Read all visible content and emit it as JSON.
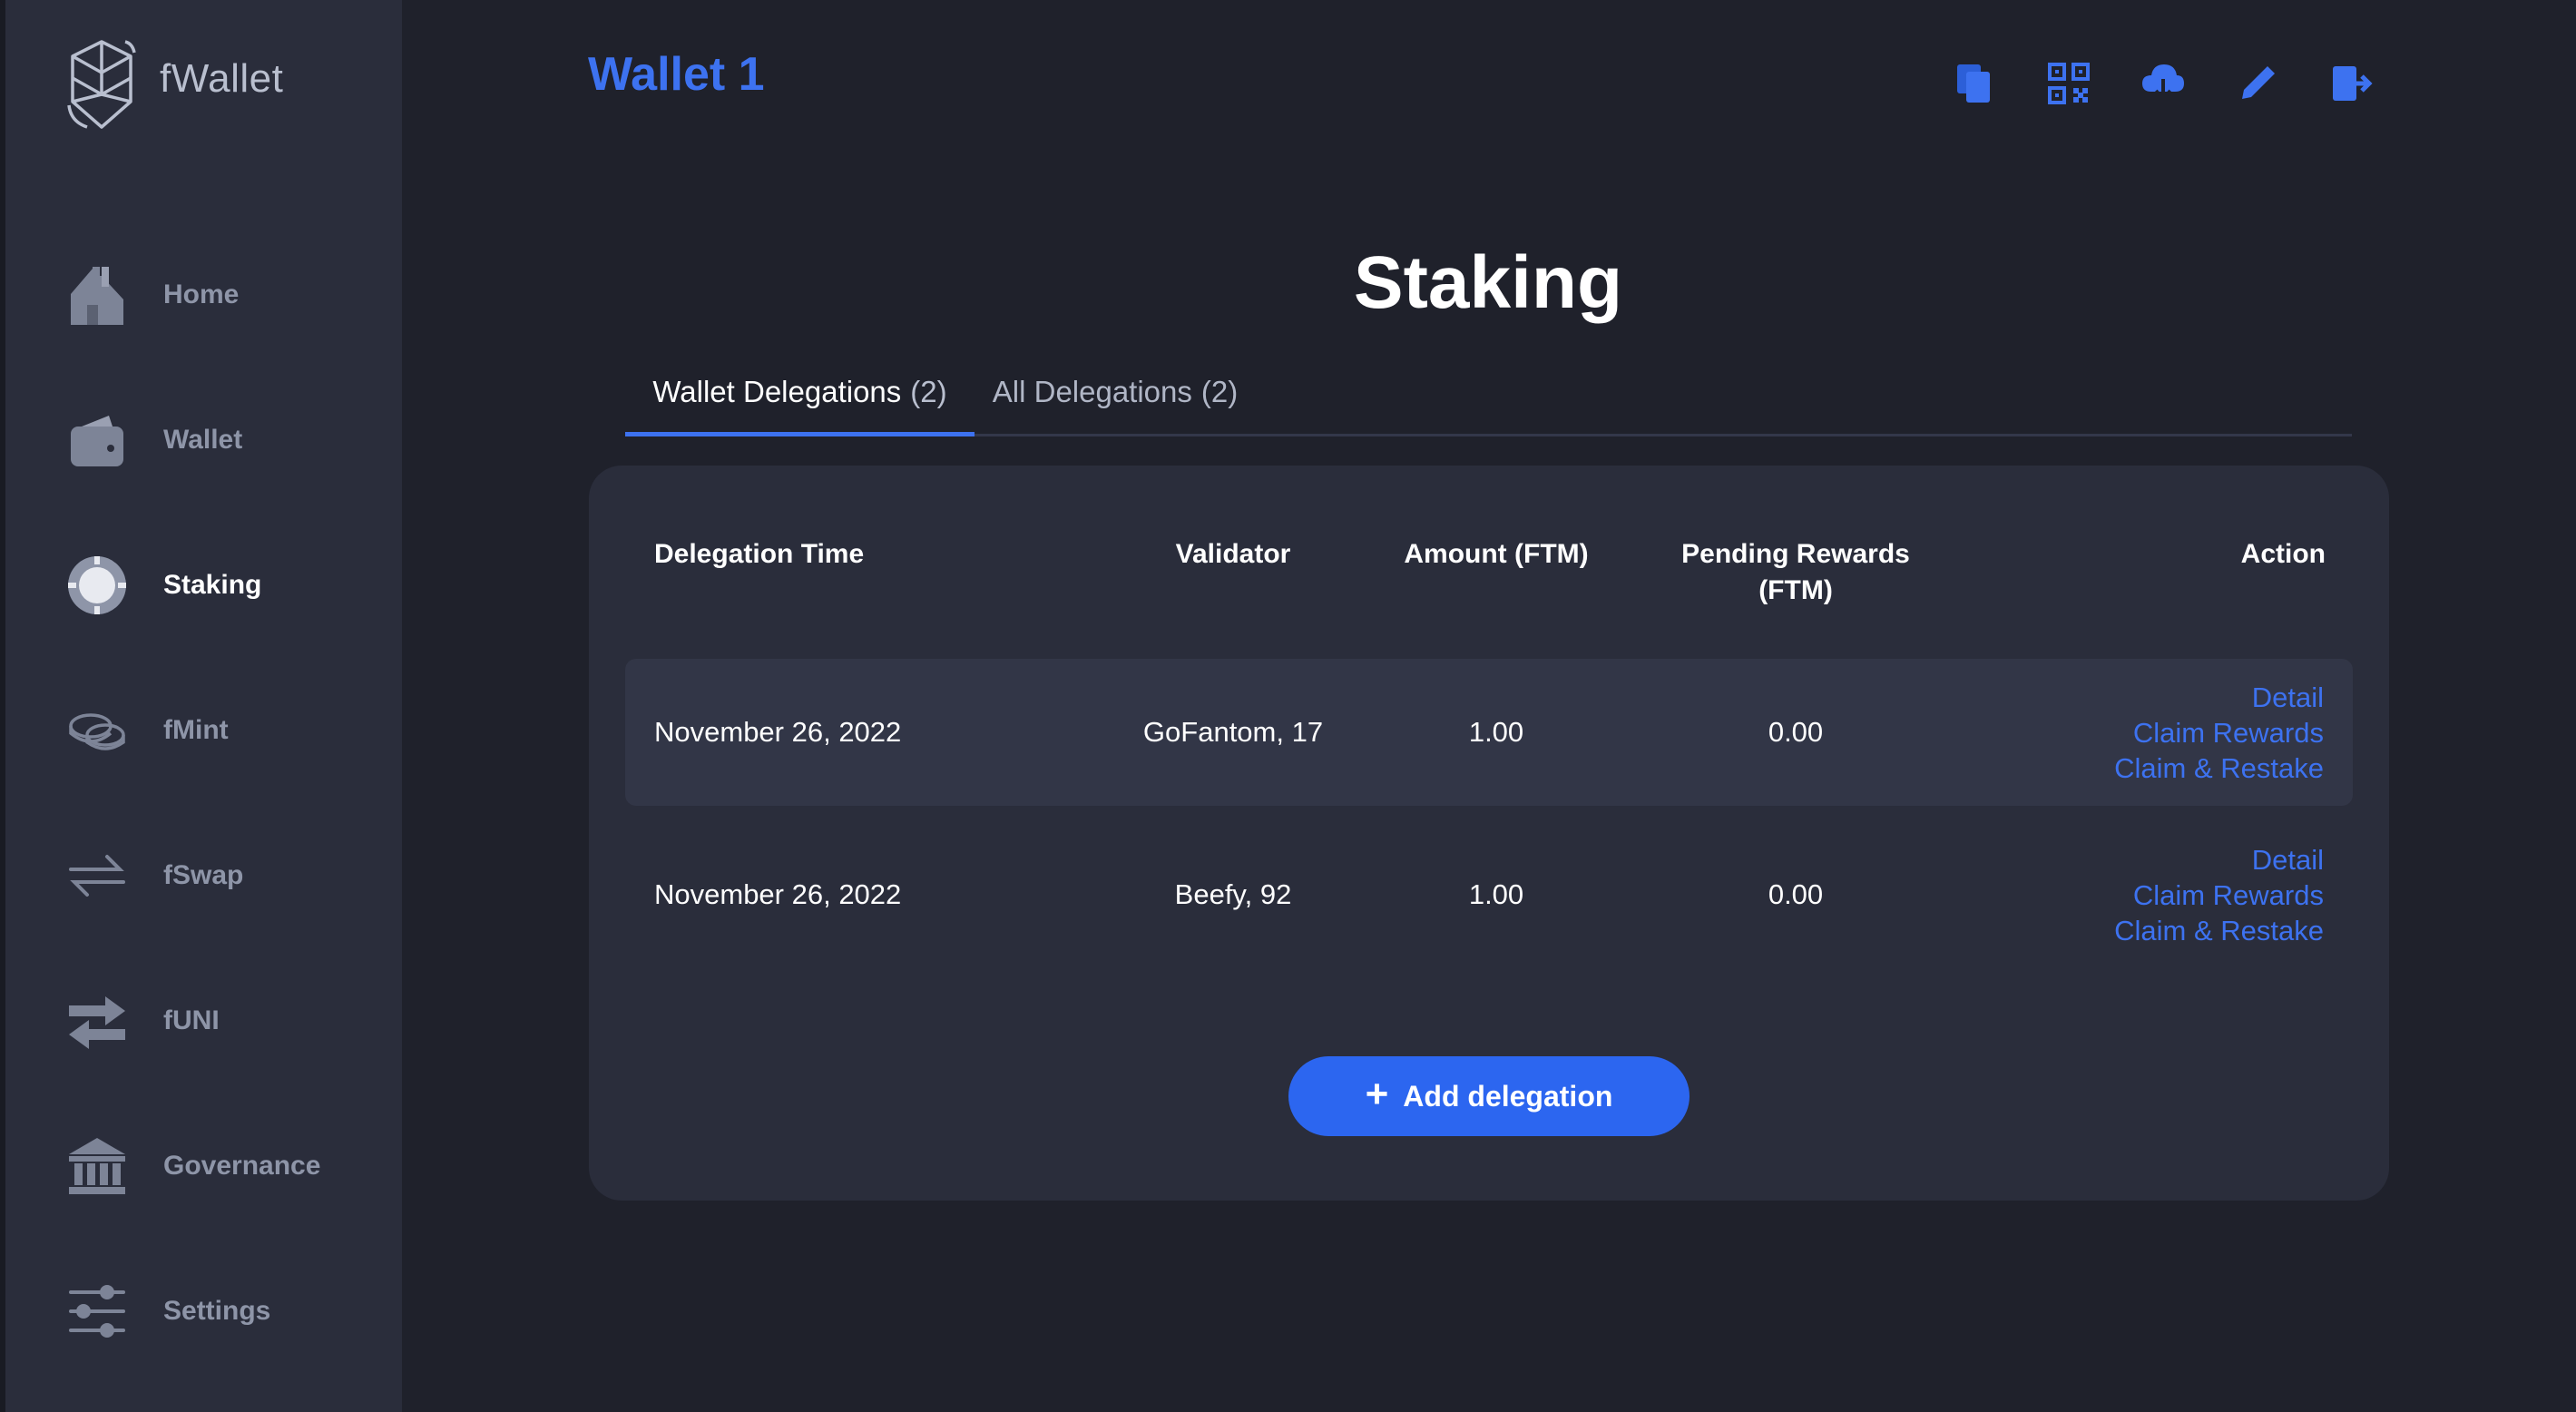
{
  "app": {
    "name": "fWallet"
  },
  "header": {
    "wallet_title": "Wallet 1"
  },
  "sidebar": {
    "items": [
      {
        "label": "Home",
        "icon": "home-icon"
      },
      {
        "label": "Wallet",
        "icon": "wallet-icon"
      },
      {
        "label": "Staking",
        "icon": "staking-icon",
        "active": true
      },
      {
        "label": "fMint",
        "icon": "coins-icon"
      },
      {
        "label": "fSwap",
        "icon": "swap-arrows-icon"
      },
      {
        "label": "fUNI",
        "icon": "exchange-icon"
      },
      {
        "label": "Governance",
        "icon": "bank-icon"
      },
      {
        "label": "Settings",
        "icon": "sliders-icon"
      }
    ]
  },
  "toolbar": {
    "icons": [
      "copy-icon",
      "qr-code-icon",
      "cloud-download-icon",
      "pencil-icon",
      "logout-icon"
    ]
  },
  "page": {
    "title": "Staking",
    "tabs": [
      {
        "label": "Wallet Delegations",
        "count": "(2)",
        "active": true
      },
      {
        "label": "All Delegations",
        "count": "(2)",
        "active": false
      }
    ]
  },
  "table": {
    "headers": {
      "time": "Delegation Time",
      "validator": "Validator",
      "amount": "Amount (FTM)",
      "rewards_line1": "Pending Rewards",
      "rewards_line2": "(FTM)",
      "action": "Action"
    },
    "rows": [
      {
        "time": "November 26, 2022",
        "validator": "GoFantom, 17",
        "amount": "1.00",
        "rewards": "0.00",
        "actions": [
          "Detail",
          "Claim Rewards",
          "Claim & Restake"
        ]
      },
      {
        "time": "November 26, 2022",
        "validator": "Beefy, 92",
        "amount": "1.00",
        "rewards": "0.00",
        "actions": [
          "Detail",
          "Claim Rewards",
          "Claim & Restake"
        ]
      }
    ]
  },
  "add_button": {
    "plus": "+",
    "label": "Add delegation"
  },
  "colors": {
    "accent": "#3d72f0",
    "button": "#2c66f0",
    "background": "#1f212b",
    "panel": "#2a2d3b",
    "muted_text": "#8e95a8"
  }
}
